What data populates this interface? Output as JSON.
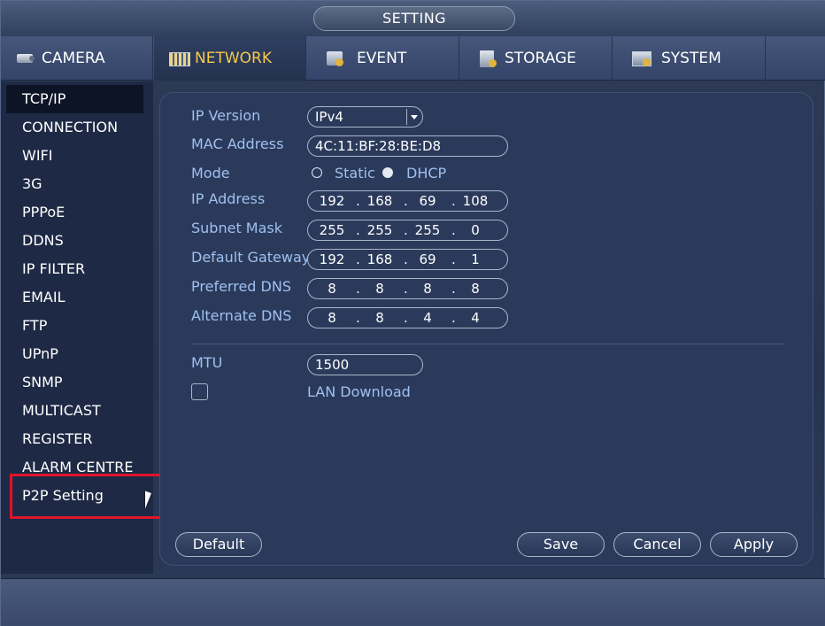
{
  "window": {
    "title": "SETTING"
  },
  "tabs": [
    {
      "label": "CAMERA",
      "icon": "camera-icon",
      "active": false
    },
    {
      "label": "NETWORK",
      "icon": "network-icon",
      "active": true
    },
    {
      "label": "EVENT",
      "icon": "event-icon",
      "active": false
    },
    {
      "label": "STORAGE",
      "icon": "storage-icon",
      "active": false
    },
    {
      "label": "SYSTEM",
      "icon": "system-icon",
      "active": false
    }
  ],
  "sidebar": {
    "items": [
      {
        "label": "TCP/IP",
        "active": true
      },
      {
        "label": "CONNECTION"
      },
      {
        "label": "WIFI"
      },
      {
        "label": "3G"
      },
      {
        "label": "PPPoE"
      },
      {
        "label": "DDNS"
      },
      {
        "label": "IP FILTER"
      },
      {
        "label": "EMAIL"
      },
      {
        "label": "FTP"
      },
      {
        "label": "UPnP"
      },
      {
        "label": "SNMP"
      },
      {
        "label": "MULTICAST"
      },
      {
        "label": "REGISTER"
      },
      {
        "label": "ALARM CENTRE"
      },
      {
        "label": "P2P Setting",
        "highlighted": true
      }
    ]
  },
  "form": {
    "ip_version": {
      "label": "IP Version",
      "value": "IPv4"
    },
    "mac_address": {
      "label": "MAC Address",
      "value": "4C:11:BF:28:BE:D8"
    },
    "mode": {
      "label": "Mode",
      "options": [
        "Static",
        "DHCP"
      ],
      "selected": "DHCP"
    },
    "ip_address": {
      "label": "IP Address",
      "octets": [
        "192",
        "168",
        "69",
        "108"
      ]
    },
    "subnet_mask": {
      "label": "Subnet Mask",
      "octets": [
        "255",
        "255",
        "255",
        "0"
      ]
    },
    "default_gateway": {
      "label": "Default Gateway",
      "octets": [
        "192",
        "168",
        "69",
        "1"
      ]
    },
    "preferred_dns": {
      "label": "Preferred DNS",
      "octets": [
        "8",
        "8",
        "8",
        "8"
      ]
    },
    "alternate_dns": {
      "label": "Alternate DNS",
      "octets": [
        "8",
        "8",
        "4",
        "4"
      ]
    },
    "mtu": {
      "label": "MTU",
      "value": "1500"
    },
    "lan_download": {
      "label": "LAN Download",
      "checked": false
    }
  },
  "buttons": {
    "default": "Default",
    "save": "Save",
    "cancel": "Cancel",
    "apply": "Apply"
  },
  "colors": {
    "active_tab_text": "#f5c94a",
    "label_text": "#9fc0ee",
    "highlight": "#e0142a"
  }
}
